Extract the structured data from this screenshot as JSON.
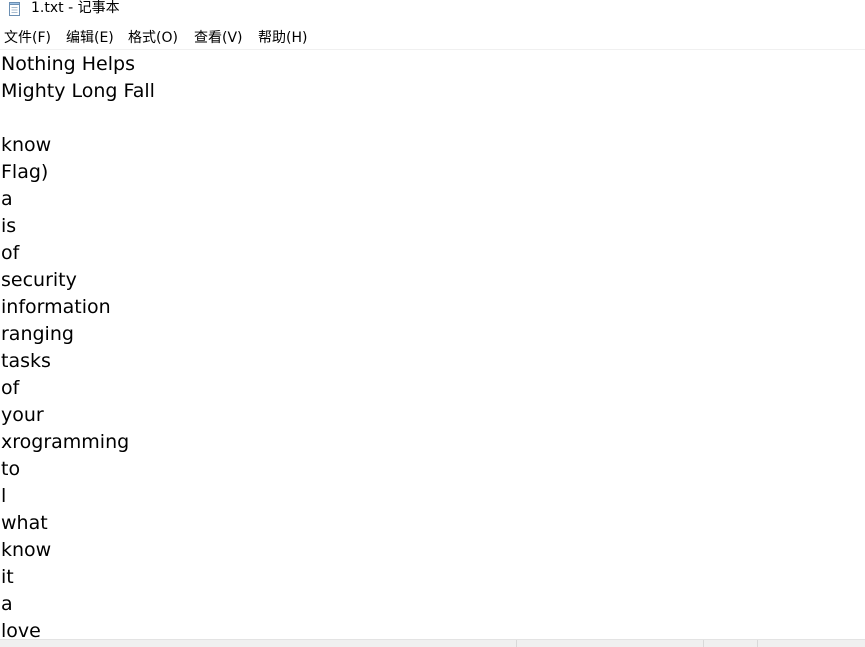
{
  "window": {
    "title": "1.txt - 记事本",
    "icon": "notepad-icon"
  },
  "menu": {
    "file": "文件(F)",
    "edit": "编辑(E)",
    "format": "格式(O)",
    "view": "查看(V)",
    "help": "帮助(H)"
  },
  "document": {
    "content": "Nothing Helps\nMighty Long Fall\n\nknow\nFlag)\na\nis\nof\nsecurity\ninformation\nranging\ntasks\nof\nyour\nxrogramming\nto\nl\nwhat\nknow\nit\na\nlove"
  }
}
